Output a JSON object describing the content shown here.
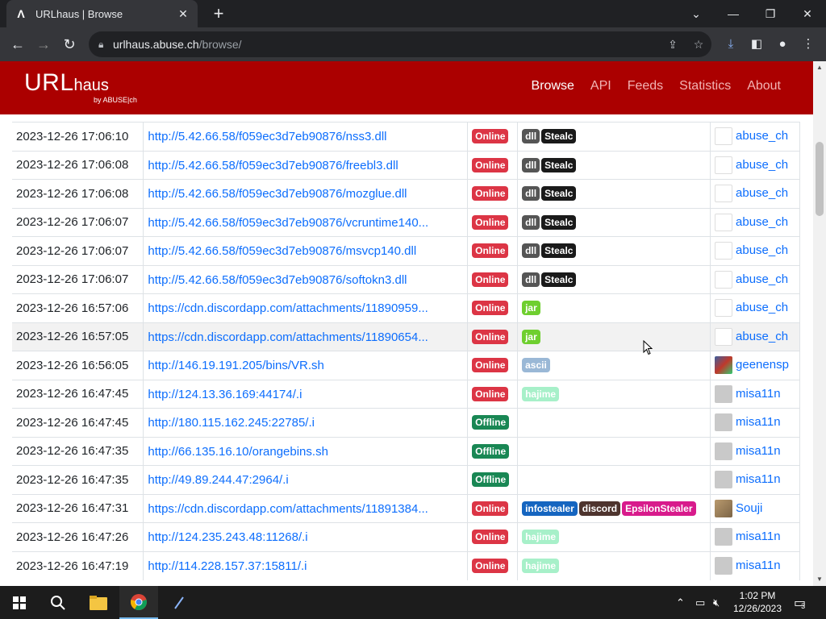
{
  "browser": {
    "tab_title": "URLhaus | Browse",
    "tab_favicon": "Λ",
    "url_host": "urlhaus.abuse.ch",
    "url_path": "/browse/"
  },
  "site": {
    "logo_main": "URL",
    "logo_sub": "haus",
    "logo_by": "by ABUSE|ch",
    "nav": [
      "Browse",
      "API",
      "Feeds",
      "Statistics",
      "About"
    ],
    "brand_color": "#ab0000"
  },
  "rows": [
    {
      "date": "2023-12-26 17:06:10",
      "url": "http://5.42.66.58/f059ec3d7eb90876/nss3.dll",
      "status": "Online",
      "tags": [
        {
          "t": "dll",
          "c": "#555555"
        },
        {
          "t": "Stealc",
          "c": "#1a1a1a"
        }
      ],
      "reporter": "abuse_ch",
      "avatar": "abuse"
    },
    {
      "date": "2023-12-26 17:06:08",
      "url": "http://5.42.66.58/f059ec3d7eb90876/freebl3.dll",
      "status": "Online",
      "tags": [
        {
          "t": "dll",
          "c": "#555555"
        },
        {
          "t": "Stealc",
          "c": "#1a1a1a"
        }
      ],
      "reporter": "abuse_ch",
      "avatar": "abuse"
    },
    {
      "date": "2023-12-26 17:06:08",
      "url": "http://5.42.66.58/f059ec3d7eb90876/mozglue.dll",
      "status": "Online",
      "tags": [
        {
          "t": "dll",
          "c": "#555555"
        },
        {
          "t": "Stealc",
          "c": "#1a1a1a"
        }
      ],
      "reporter": "abuse_ch",
      "avatar": "abuse"
    },
    {
      "date": "2023-12-26 17:06:07",
      "url": "http://5.42.66.58/f059ec3d7eb90876/vcruntime140...",
      "status": "Online",
      "tags": [
        {
          "t": "dll",
          "c": "#555555"
        },
        {
          "t": "Stealc",
          "c": "#1a1a1a"
        }
      ],
      "reporter": "abuse_ch",
      "avatar": "abuse"
    },
    {
      "date": "2023-12-26 17:06:07",
      "url": "http://5.42.66.58/f059ec3d7eb90876/msvcp140.dll",
      "status": "Online",
      "tags": [
        {
          "t": "dll",
          "c": "#555555"
        },
        {
          "t": "Stealc",
          "c": "#1a1a1a"
        }
      ],
      "reporter": "abuse_ch",
      "avatar": "abuse"
    },
    {
      "date": "2023-12-26 17:06:07",
      "url": "http://5.42.66.58/f059ec3d7eb90876/softokn3.dll",
      "status": "Online",
      "tags": [
        {
          "t": "dll",
          "c": "#555555"
        },
        {
          "t": "Stealc",
          "c": "#1a1a1a"
        }
      ],
      "reporter": "abuse_ch",
      "avatar": "abuse"
    },
    {
      "date": "2023-12-26 16:57:06",
      "url": "https://cdn.discordapp.com/attachments/11890959...",
      "status": "Online",
      "tags": [
        {
          "t": "jar",
          "c": "#6fcf2f"
        }
      ],
      "reporter": "abuse_ch",
      "avatar": "abuse"
    },
    {
      "date": "2023-12-26 16:57:05",
      "url": "https://cdn.discordapp.com/attachments/11890654...",
      "status": "Online",
      "tags": [
        {
          "t": "jar",
          "c": "#6fcf2f"
        }
      ],
      "reporter": "abuse_ch",
      "avatar": "abuse"
    },
    {
      "date": "2023-12-26 16:56:05",
      "url": "http://146.19.191.205/bins/VR.sh",
      "status": "Online",
      "tags": [
        {
          "t": "ascii",
          "c": "#9ab8d6"
        }
      ],
      "reporter": "geenensp",
      "avatar": "gee"
    },
    {
      "date": "2023-12-26 16:47:45",
      "url": "http://124.13.36.169:44174/.i",
      "status": "Online",
      "tags": [
        {
          "t": "hajime",
          "c": "#a7f0c9"
        }
      ],
      "reporter": "misa11n",
      "avatar": "misa"
    },
    {
      "date": "2023-12-26 16:47:45",
      "url": "http://180.115.162.245:22785/.i",
      "status": "Offline",
      "tags": [],
      "reporter": "misa11n",
      "avatar": "misa"
    },
    {
      "date": "2023-12-26 16:47:35",
      "url": "http://66.135.16.10/orangebins.sh",
      "status": "Offline",
      "tags": [],
      "reporter": "misa11n",
      "avatar": "misa"
    },
    {
      "date": "2023-12-26 16:47:35",
      "url": "http://49.89.244.47:2964/.i",
      "status": "Offline",
      "tags": [],
      "reporter": "misa11n",
      "avatar": "misa"
    },
    {
      "date": "2023-12-26 16:47:31",
      "url": "https://cdn.discordapp.com/attachments/11891384...",
      "status": "Online",
      "tags": [
        {
          "t": "infostealer",
          "c": "#1565c0"
        },
        {
          "t": "discord",
          "c": "#4e342e"
        },
        {
          "t": "EpsilonStealer",
          "c": "#d81b8c"
        }
      ],
      "reporter": "Souji",
      "avatar": "souji"
    },
    {
      "date": "2023-12-26 16:47:26",
      "url": "http://124.235.243.48:11268/.i",
      "status": "Online",
      "tags": [
        {
          "t": "hajime",
          "c": "#a7f0c9"
        }
      ],
      "reporter": "misa11n",
      "avatar": "misa"
    },
    {
      "date": "2023-12-26 16:47:19",
      "url": "http://114.228.157.37:15811/.i",
      "status": "Online",
      "tags": [
        {
          "t": "hajime",
          "c": "#a7f0c9"
        }
      ],
      "reporter": "misa11n",
      "avatar": "misa"
    }
  ],
  "taskbar": {
    "time": "1:02 PM",
    "date": "12/26/2023",
    "notif_count": "3"
  }
}
